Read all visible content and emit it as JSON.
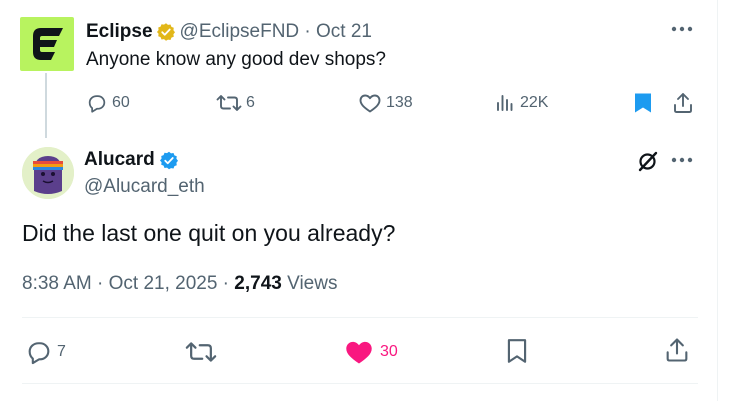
{
  "parent_tweet": {
    "author_name": "Eclipse",
    "handle": "@EclipseFND",
    "separator": " · ",
    "date": "Oct 21",
    "text": "Anyone know any good dev shops?",
    "avatar_icon": "eclipse-logo-icon",
    "avatar_color": "#b8f35f",
    "verified_badge": "gold-verified-badge-icon",
    "actions": {
      "replies": "60",
      "reposts": "6",
      "likes": "138",
      "views": "22K",
      "bookmarked": true
    }
  },
  "reply_tweet": {
    "author_name": "Alucard",
    "handle": "@Alucard_eth",
    "verified_badge": "blue-verified-badge-icon",
    "text": "Did the last one quit on you already?",
    "time": "8:38 AM",
    "sep1": " · ",
    "date": "Oct 21, 2025",
    "sep2": " · ",
    "views_count": "2,743",
    "views_label": " Views",
    "actions": {
      "replies": "7",
      "likes": "30",
      "liked": true
    }
  },
  "colors": {
    "text_primary": "#0f1419",
    "text_secondary": "#536471",
    "accent_blue": "#1d9bf0",
    "like_pink": "#f91880",
    "gold": "#e2b719",
    "divider": "#eff3f4"
  }
}
